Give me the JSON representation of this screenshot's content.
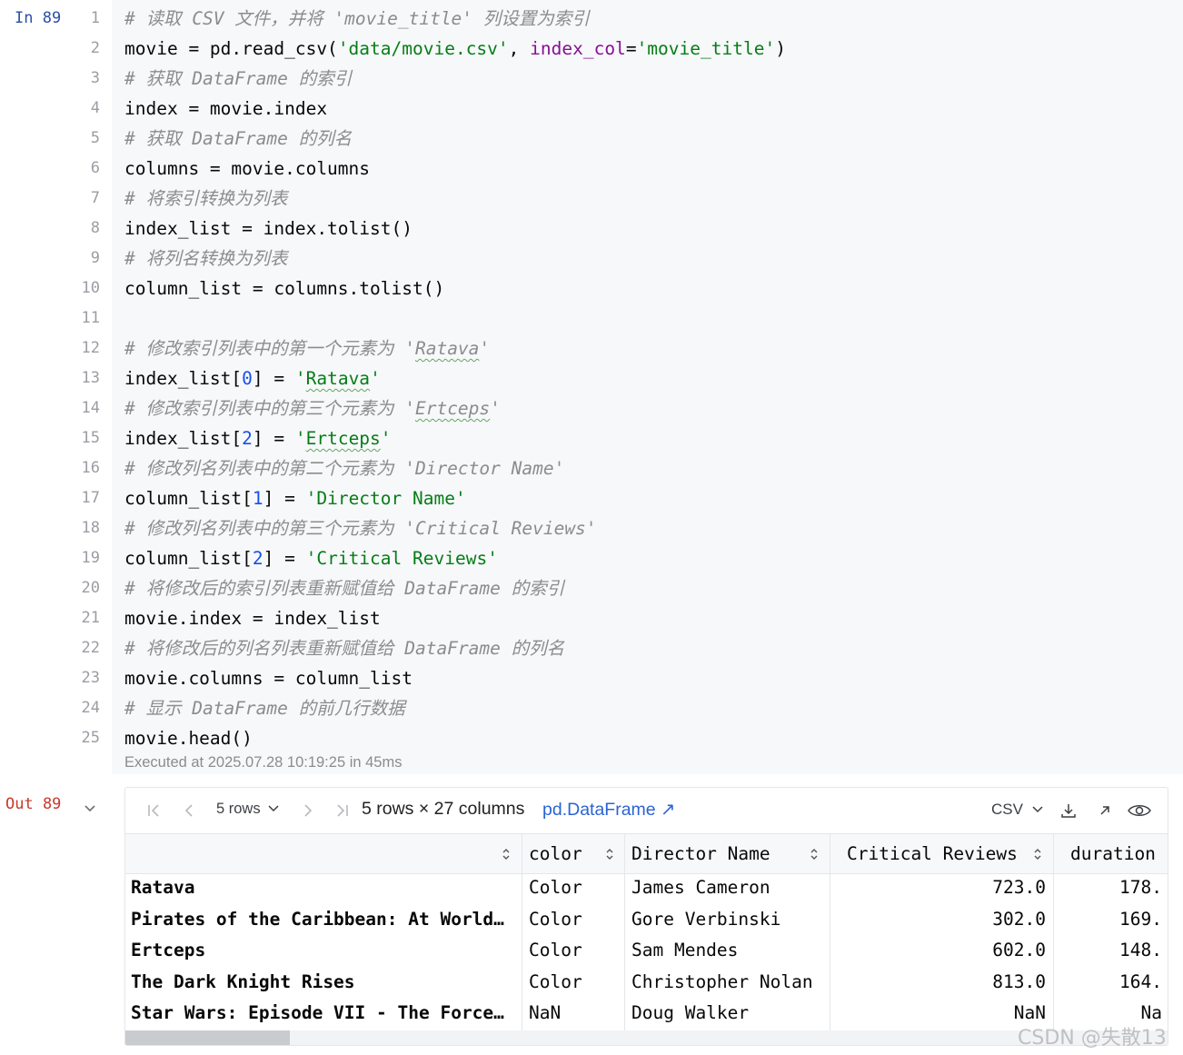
{
  "input_cell": {
    "prompt": "In 89",
    "line_numbers": [
      "1",
      "2",
      "3",
      "4",
      "5",
      "6",
      "7",
      "8",
      "9",
      "10",
      "11",
      "12",
      "13",
      "14",
      "15",
      "16",
      "17",
      "18",
      "19",
      "20",
      "21",
      "22",
      "23",
      "24",
      "25"
    ],
    "lines": [
      [
        {
          "t": "# 读取 CSV 文件，并将 'movie_title' 列设置为索引",
          "k": "c"
        }
      ],
      [
        {
          "t": "movie = pd.read_csv(",
          "k": ""
        },
        {
          "t": "'data/movie.csv'",
          "k": "s"
        },
        {
          "t": ", ",
          "k": ""
        },
        {
          "t": "index_col",
          "k": "kw"
        },
        {
          "t": "=",
          "k": ""
        },
        {
          "t": "'movie_title'",
          "k": "s"
        },
        {
          "t": ")",
          "k": ""
        }
      ],
      [
        {
          "t": "# 获取 DataFrame 的索引",
          "k": "c"
        }
      ],
      [
        {
          "t": "index = movie.index",
          "k": ""
        }
      ],
      [
        {
          "t": "# 获取 DataFrame 的列名",
          "k": "c"
        }
      ],
      [
        {
          "t": "columns = movie.columns",
          "k": ""
        }
      ],
      [
        {
          "t": "# 将索引转换为列表",
          "k": "c"
        }
      ],
      [
        {
          "t": "index_list = index.tolist()",
          "k": ""
        }
      ],
      [
        {
          "t": "# 将列名转换为列表",
          "k": "c"
        }
      ],
      [
        {
          "t": "column_list = columns.tolist()",
          "k": ""
        }
      ],
      [],
      [
        {
          "t": "# 修改索引列表中的第一个元素为 '",
          "k": "c"
        },
        {
          "t": "Ratava",
          "k": "c sq"
        },
        {
          "t": "'",
          "k": "c"
        }
      ],
      [
        {
          "t": "index_list[",
          "k": ""
        },
        {
          "t": "0",
          "k": "n"
        },
        {
          "t": "] = ",
          "k": ""
        },
        {
          "t": "'",
          "k": "s"
        },
        {
          "t": "Ratava",
          "k": "s sq"
        },
        {
          "t": "'",
          "k": "s"
        }
      ],
      [
        {
          "t": "# 修改索引列表中的第三个元素为 '",
          "k": "c"
        },
        {
          "t": "Ertceps",
          "k": "c sq"
        },
        {
          "t": "'",
          "k": "c"
        }
      ],
      [
        {
          "t": "index_list[",
          "k": ""
        },
        {
          "t": "2",
          "k": "n"
        },
        {
          "t": "] = ",
          "k": ""
        },
        {
          "t": "'",
          "k": "s"
        },
        {
          "t": "Ertceps",
          "k": "s sq"
        },
        {
          "t": "'",
          "k": "s"
        }
      ],
      [
        {
          "t": "# 修改列名列表中的第二个元素为 'Director Name'",
          "k": "c"
        }
      ],
      [
        {
          "t": "column_list[",
          "k": ""
        },
        {
          "t": "1",
          "k": "n"
        },
        {
          "t": "] = ",
          "k": ""
        },
        {
          "t": "'Director Name'",
          "k": "s"
        }
      ],
      [
        {
          "t": "# 修改列名列表中的第三个元素为 'Critical Reviews'",
          "k": "c"
        }
      ],
      [
        {
          "t": "column_list[",
          "k": ""
        },
        {
          "t": "2",
          "k": "n"
        },
        {
          "t": "] = ",
          "k": ""
        },
        {
          "t": "'Critical Reviews'",
          "k": "s"
        }
      ],
      [
        {
          "t": "# 将修改后的索引列表重新赋值给 DataFrame 的索引",
          "k": "c"
        }
      ],
      [
        {
          "t": "movie.index = index_list",
          "k": ""
        }
      ],
      [
        {
          "t": "# 将修改后的列名列表重新赋值给 DataFrame 的列名",
          "k": "c"
        }
      ],
      [
        {
          "t": "movie.columns = column_list",
          "k": ""
        }
      ],
      [
        {
          "t": "# 显示 DataFrame 的前几行数据",
          "k": "c"
        }
      ],
      [
        {
          "t": "movie.head()",
          "k": ""
        }
      ]
    ],
    "executed": "Executed at 2025.07.28 10:19:25 in 45ms"
  },
  "output_cell": {
    "prompt": "Out 89",
    "toolbar": {
      "rows_selector": "5 rows",
      "summary": "5 rows × 27 columns",
      "df_type": "pd.DataFrame ↗",
      "export_format": "CSV"
    },
    "table": {
      "columns": [
        "color",
        "Director Name",
        "Critical Reviews",
        "duration"
      ],
      "rows": [
        {
          "index": "Ratava",
          "cells": [
            "Color",
            "James Cameron",
            "723.0",
            "178."
          ]
        },
        {
          "index": "Pirates of the Caribbean: At World…",
          "cells": [
            "Color",
            "Gore Verbinski",
            "302.0",
            "169."
          ]
        },
        {
          "index": "Ertceps",
          "cells": [
            "Color",
            "Sam Mendes",
            "602.0",
            "148."
          ]
        },
        {
          "index": "The Dark Knight Rises",
          "cells": [
            "Color",
            "Christopher Nolan",
            "813.0",
            "164."
          ]
        },
        {
          "index": "Star Wars: Episode VII - The Force…",
          "cells": [
            "NaN",
            "Doug Walker",
            "NaN",
            "Na"
          ]
        }
      ]
    }
  },
  "watermark": "CSDN @失散13",
  "colors": {
    "comment": "#8c8c8c",
    "string": "#067d17",
    "number": "#1750eb",
    "keyword": "#871094",
    "in_prompt": "#2b4fa8",
    "out_prompt": "#c7392b",
    "link": "#2b63d4"
  }
}
